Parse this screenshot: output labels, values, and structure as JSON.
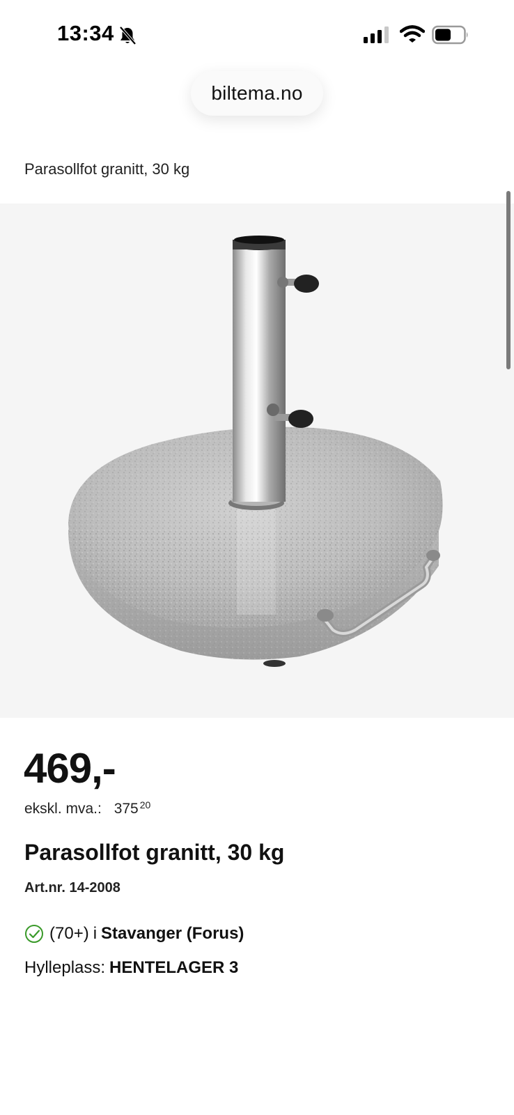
{
  "status_bar": {
    "time": "13:34",
    "icons": [
      "bell-slash-icon",
      "cellular-signal-icon",
      "wifi-icon",
      "battery-icon"
    ]
  },
  "browser": {
    "url": "biltema.no"
  },
  "breadcrumb": {
    "label": "Parasollfot granitt, 30 kg"
  },
  "product": {
    "image_icon": "umbrella-base-photo",
    "price": "469,-",
    "vat_label": "ekskl. mva.:",
    "vat_price_main": "375",
    "vat_price_cents": "20",
    "title": "Parasollfot granitt, 30 kg",
    "article_number": "Art.nr. 14-2008"
  },
  "stock": {
    "icon": "check-circle-icon",
    "count": "(70+)",
    "preposition": "i",
    "store": "Stavanger (Forus)",
    "shelf_label": "Hylleplass:",
    "shelf_value": "HENTELAGER 3"
  },
  "colors": {
    "accent_green": "#3a9a2a",
    "image_background": "#f5f5f5",
    "text": "#111111"
  }
}
